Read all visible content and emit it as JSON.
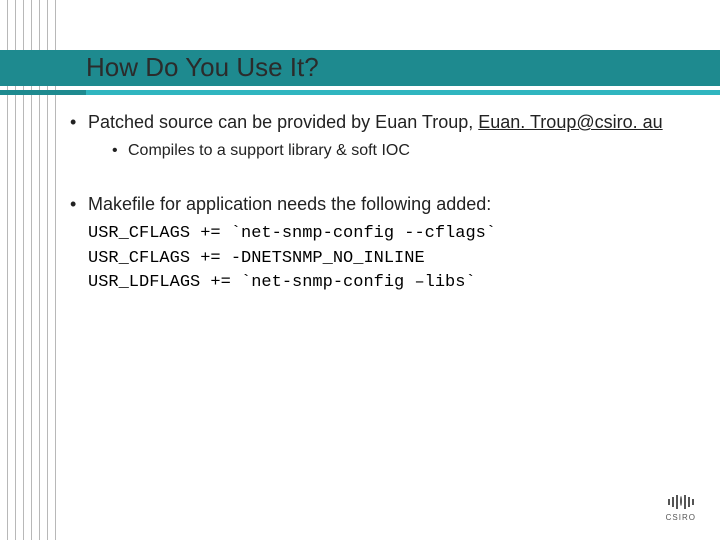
{
  "header": {
    "title": "How Do You Use It?"
  },
  "bullets": {
    "b1a_pre": "Patched source can be provided by Euan Troup, ",
    "b1a_email": "Euan. Troup@csiro. au",
    "b1a_sub": "Compiles to a support library & soft IOC",
    "b2": "Makefile for application needs the following added:"
  },
  "code": {
    "l1": "USR_CFLAGS += `net-snmp-config --cflags`",
    "l2": "USR_CFLAGS += -DNETSNMP_NO_INLINE",
    "l3": "USR_LDFLAGS += `net-snmp-config –libs`"
  },
  "logo": {
    "text": "CSIRO"
  }
}
